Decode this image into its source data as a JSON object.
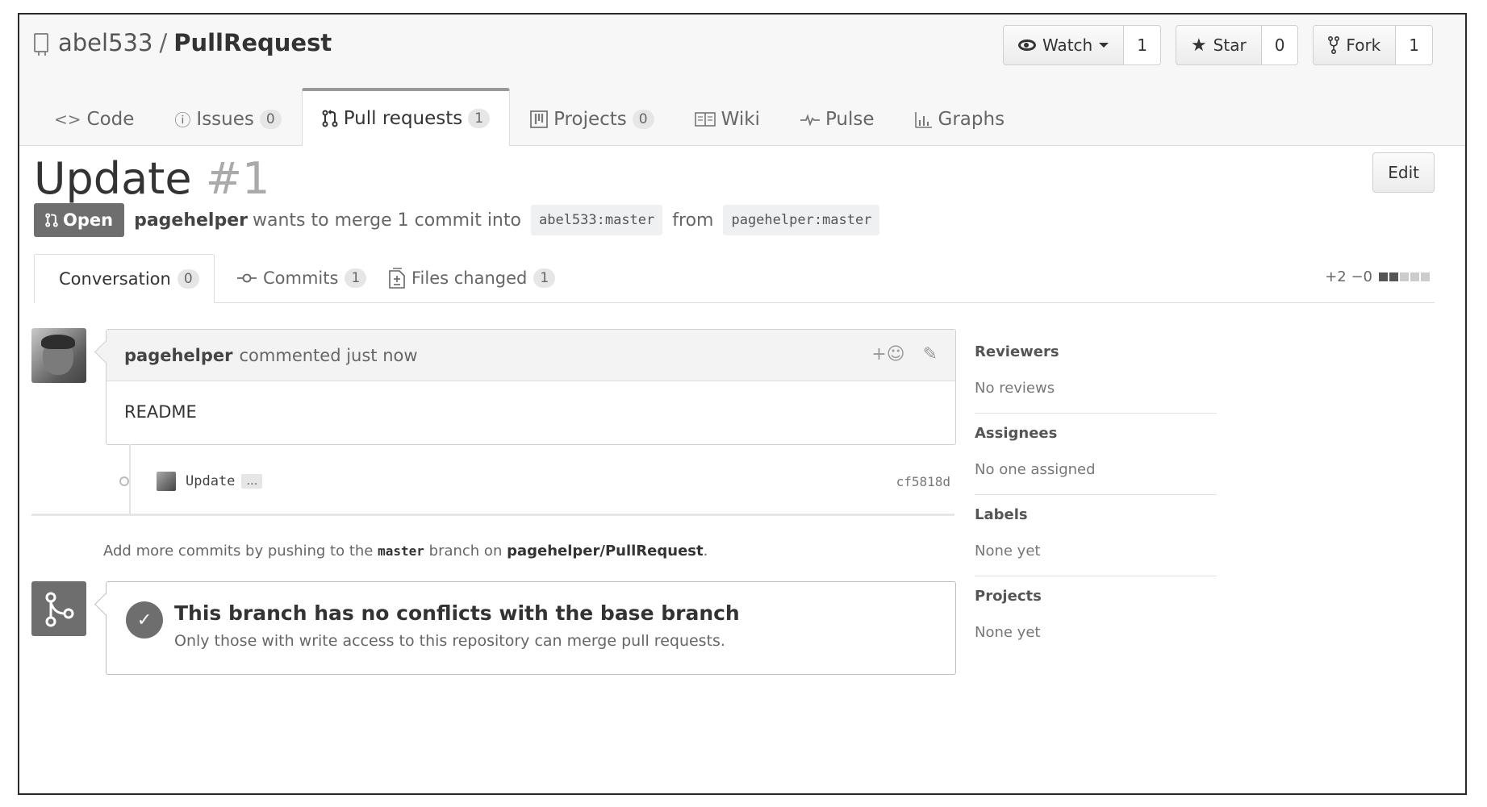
{
  "repo": {
    "owner": "abel533",
    "separator": "/",
    "name": "PullRequest"
  },
  "actions": {
    "watch": {
      "label": "Watch",
      "count": "1"
    },
    "star": {
      "label": "Star",
      "count": "0"
    },
    "fork": {
      "label": "Fork",
      "count": "1"
    }
  },
  "nav": {
    "code": {
      "label": "Code"
    },
    "issues": {
      "label": "Issues",
      "count": "0"
    },
    "pulls": {
      "label": "Pull requests",
      "count": "1"
    },
    "projects": {
      "label": "Projects",
      "count": "0"
    },
    "wiki": {
      "label": "Wiki"
    },
    "pulse": {
      "label": "Pulse"
    },
    "graphs": {
      "label": "Graphs"
    }
  },
  "pr": {
    "title": "Update",
    "number": "#1",
    "edit_label": "Edit",
    "state": "Open",
    "author": "pagehelper",
    "merge_text": "wants to merge 1 commit into",
    "base_branch": "abel533:master",
    "from_text": "from",
    "head_branch": "pagehelper:master"
  },
  "tabs": {
    "conversation": {
      "label": "Conversation",
      "count": "0"
    },
    "commits": {
      "label": "Commits",
      "count": "1"
    },
    "files": {
      "label": "Files changed",
      "count": "1"
    },
    "diffstat": "+2 −0"
  },
  "comment": {
    "author": "pagehelper",
    "meta": "commented just now",
    "body": "README",
    "reaction": "+☺",
    "edit_icon": "✎"
  },
  "commit": {
    "message": "Update",
    "ellipsis": "…",
    "sha": "cf5818d"
  },
  "push_note": {
    "prefix": "Add more commits by pushing to the",
    "branch": "master",
    "middle": "branch on",
    "repo": "pagehelper/PullRequest",
    "suffix": "."
  },
  "merge": {
    "heading": "This branch has no conflicts with the base branch",
    "sub": "Only those with write access to this repository can merge pull requests."
  },
  "sidebar": {
    "reviewers": {
      "title": "Reviewers",
      "value": "No reviews"
    },
    "assignees": {
      "title": "Assignees",
      "value": "No one assigned"
    },
    "labels": {
      "title": "Labels",
      "value": "None yet"
    },
    "projects": {
      "title": "Projects",
      "value": "None yet"
    }
  },
  "colors": {
    "accent_gray": "#6e6e6e",
    "border": "#cfcfcf",
    "header_bg": "#f7f7f7"
  }
}
